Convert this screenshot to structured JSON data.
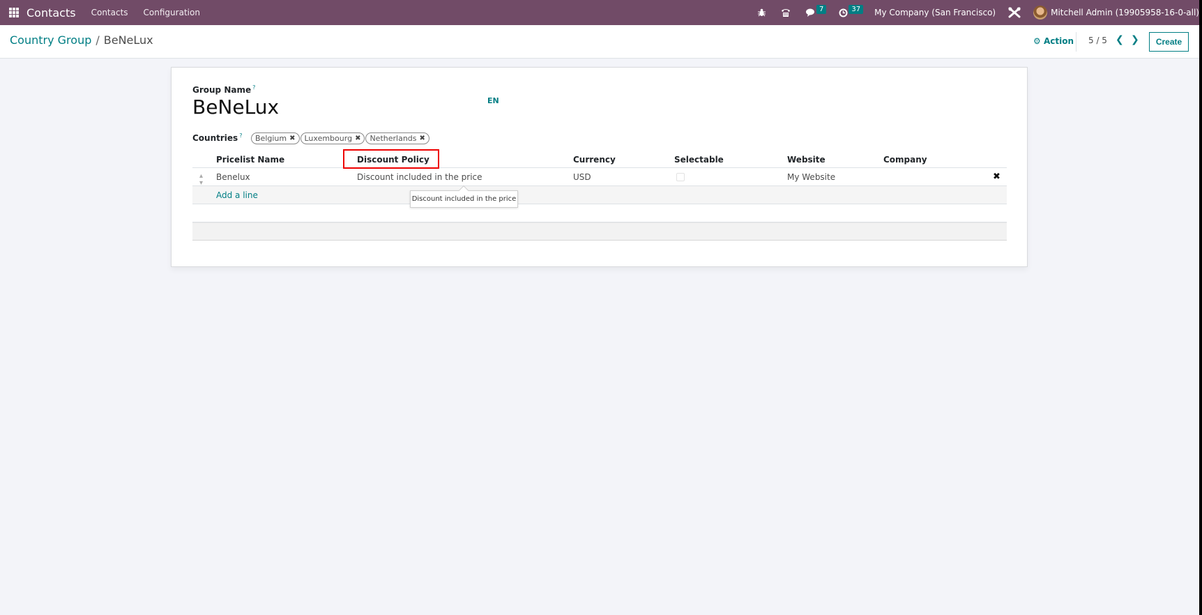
{
  "navbar": {
    "app_name": "Contacts",
    "menus": [
      "Contacts",
      "Configuration"
    ],
    "icons": {
      "debug": "bug-icon",
      "voip": "phone-icon",
      "messages": "chat-icon",
      "activities": "clock-icon",
      "settings": "tools-icon"
    },
    "messages_count": "7",
    "activities_count": "37",
    "company": "My Company (San Francisco)",
    "user": "Mitchell Admin (19905958-16-0-all)"
  },
  "control_panel": {
    "breadcrumb_parent": "Country Group",
    "breadcrumb_separator": "/",
    "breadcrumb_current": "BeNeLux",
    "action_label": "Action",
    "pager": "5 / 5",
    "create_label": "Create"
  },
  "form": {
    "group_name_label": "Group Name",
    "help_mark": "?",
    "group_name_value": "BeNeLux",
    "lang_button": "EN",
    "countries_label": "Countries",
    "countries": [
      "Belgium",
      "Luxembourg",
      "Netherlands"
    ],
    "pricelists": {
      "columns": [
        "Pricelist Name",
        "Discount Policy",
        "Currency",
        "Selectable",
        "Website",
        "Company"
      ],
      "rows": [
        {
          "name": "Benelux",
          "discount_policy": "Discount included in the price",
          "currency": "USD",
          "selectable": false,
          "website": "My Website",
          "company": ""
        }
      ],
      "add_line_label": "Add a line"
    },
    "tooltip": "Discount included in the price",
    "highlight_color": "#e00000"
  },
  "colors": {
    "navbar": "#714B67",
    "accent": "#017e84"
  }
}
